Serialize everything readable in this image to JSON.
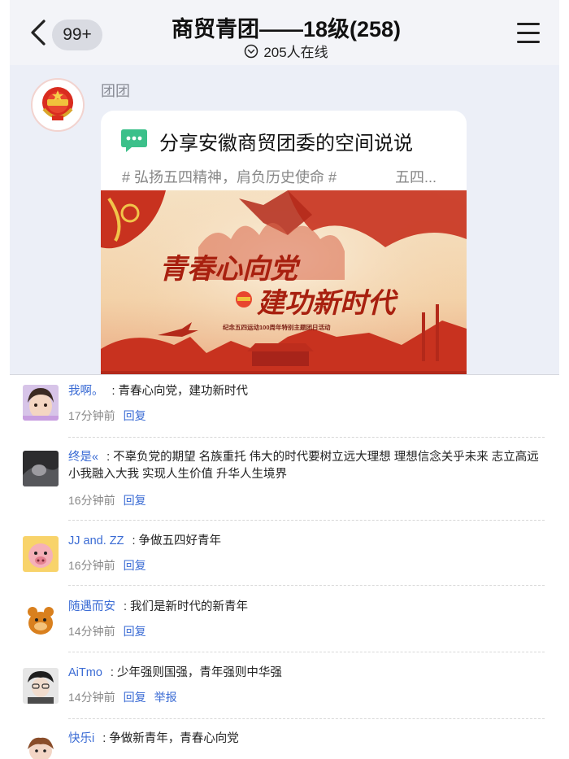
{
  "chat": {
    "badge": "99+",
    "title": "商贸青团——18级(258)",
    "online": "205人在线",
    "sender": "团团"
  },
  "share": {
    "title": "分享安徽商贸团委的空间说说",
    "tags": "# 弘扬五四精神，肩负历史使命 #",
    "more": "五四...",
    "poster_line1": "青春心向党",
    "poster_line2": "建功新时代",
    "poster_sub": "纪念五四运动100周年特别主题团日活动"
  },
  "comments": [
    {
      "name": "我啊。",
      "text": "青春心向党，建功新时代",
      "time": "17分钟前",
      "reply": "回复",
      "report": ""
    },
    {
      "name": "终是«",
      "text": "不辜负党的期望 名族重托 伟大的时代要树立远大理想 理想信念关乎未来 志立高远小我融入大我 实现人生价值 升华人生境界",
      "time": "16分钟前",
      "reply": "回复",
      "report": ""
    },
    {
      "name": "JJ and. ZZ",
      "text": "争做五四好青年",
      "time": "16分钟前",
      "reply": "回复",
      "report": ""
    },
    {
      "name": "随遇而安",
      "text": "我们是新时代的新青年",
      "time": "14分钟前",
      "reply": "回复",
      "report": ""
    },
    {
      "name": "AiTmo",
      "text": "少年强则国强，青年强则中华强",
      "time": "14分钟前",
      "reply": "回复",
      "report": "举报"
    },
    {
      "name": "快乐i",
      "text": "争做新青年，青春心向党",
      "time": "",
      "reply": "",
      "report": ""
    }
  ],
  "colors": {
    "link": "#3a6bd4",
    "chat_bg": "#eceff7",
    "poster_red": "#c8321f",
    "share_icon": "#3cc08a"
  },
  "icons": {
    "back": "chevron-left-icon",
    "online": "chevron-down-circle-icon",
    "menu": "hamburger-menu-icon",
    "share": "chat-bubble-icon"
  }
}
